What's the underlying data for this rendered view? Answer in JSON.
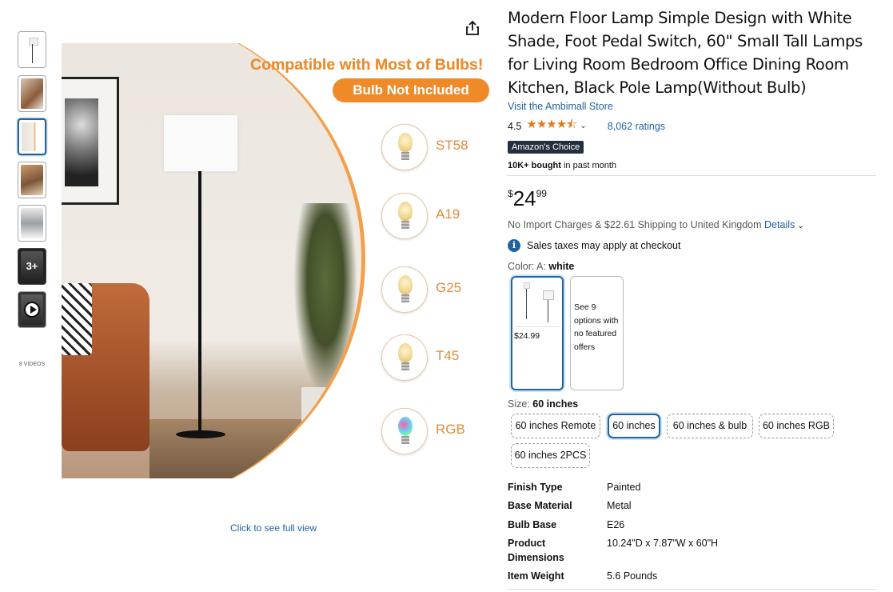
{
  "thumbnails": {
    "more_label": "3+",
    "videos_label": "8 VIDEOS"
  },
  "main_image": {
    "headline": "Compatible with Most of Bulbs!",
    "pill": "Bulb Not Included",
    "bulbs": [
      "ST58",
      "A19",
      "G25",
      "T45",
      "RGB"
    ],
    "full_view_link": "Click to see full view"
  },
  "product": {
    "title": "Modern Floor Lamp Simple Design with White Shade, Foot Pedal Switch, 60\" Small Tall Lamps for Living Room Bedroom Office Dining Room Kitchen, Black Pole Lamp(Without Bulb)",
    "store_link": "Visit the Ambimall Store",
    "rating": "4.5",
    "ratings_count": "8,062 ratings",
    "badge": "Amazon's Choice",
    "bought_bold": "10K+ bought",
    "bought_rest": " in past month",
    "stars": "★★★★⯪"
  },
  "price": {
    "symbol": "$",
    "whole": "24",
    "fraction": "99"
  },
  "shipping": {
    "text": "No Import Charges & $22.61 Shipping to United Kingdom ",
    "details_link": "Details"
  },
  "tax_note": "Sales taxes may apply at checkout",
  "color": {
    "label": "Color: A: ",
    "value": "white",
    "selected_price": "$24.99",
    "other_option_text": "See 9 options with no featured offers"
  },
  "size": {
    "label": "Size: ",
    "value": "60 inches",
    "options": [
      "60 inches Remote",
      "60 inches",
      "60 inches & bulb",
      "60 inches RGB",
      "60 inches 2PCS"
    ]
  },
  "specs": [
    {
      "key": "Finish Type",
      "value": "Painted"
    },
    {
      "key": "Base Material",
      "value": "Metal"
    },
    {
      "key": "Bulb Base",
      "value": "E26"
    },
    {
      "key": "Product Dimensions",
      "value": "10.24\"D x 7.87\"W x 60\"H"
    },
    {
      "key": "Item Weight",
      "value": "5.6 Pounds"
    }
  ],
  "colors": {
    "accent_link": "#2162a1",
    "star_orange": "#de7921",
    "badge_bg": "#232f3e",
    "promo_orange": "#ef8a29"
  }
}
